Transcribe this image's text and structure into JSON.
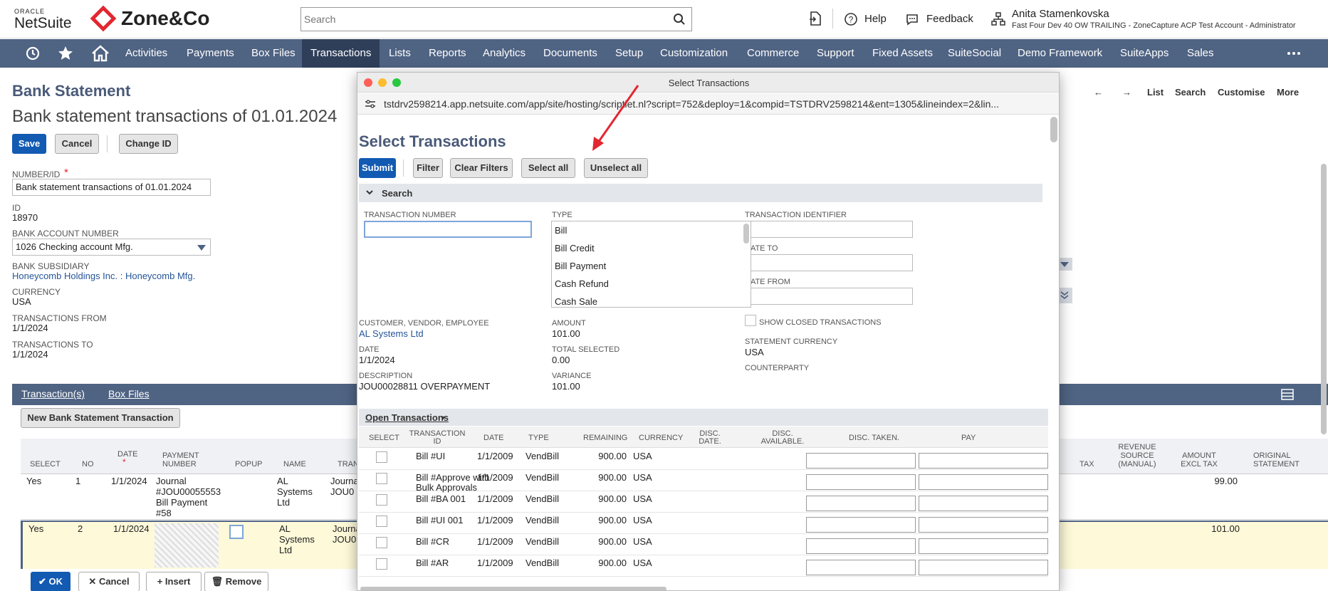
{
  "header": {
    "oracle_label": "ORACLE",
    "netsuite_label": "NetSuite",
    "zone_label": "Zone&Co",
    "search_placeholder": "Search",
    "help_label": "Help",
    "feedback_label": "Feedback",
    "user_name": "Anita Stamenkovska",
    "account": "Fast Four Dev 40 OW TRAILING - ZoneCapture ACP Test Account - Administrator",
    "brand_color": "#e3262f"
  },
  "nav": {
    "items": [
      "Activities",
      "Payments",
      "Box Files",
      "Transactions",
      "Lists",
      "Reports",
      "Analytics",
      "Documents",
      "Setup",
      "Customization",
      "Commerce",
      "Support",
      "Fixed Assets",
      "SuiteSocial",
      "Demo Framework",
      "SuiteApps",
      "Sales"
    ],
    "active": "Transactions",
    "color": "#4f6383"
  },
  "record": {
    "title": "Bank Statement",
    "subtitle": "Bank statement transactions of 01.01.2024",
    "save": "Save",
    "cancel": "Cancel",
    "change_id": "Change ID",
    "number_label": "NUMBER/ID",
    "number_value": "Bank statement transactions of 01.01.2024",
    "id_label": "ID",
    "id_value": "18970",
    "bank_account_label": "BANK ACCOUNT NUMBER",
    "bank_account_value": "1026 Checking account Mfg.",
    "subsidiary_label": "BANK SUBSIDIARY",
    "subsidiary_value": "Honeycomb Holdings Inc. : Honeycomb Mfg.",
    "currency_label": "CURRENCY",
    "currency_value": "USA",
    "from_label": "TRANSACTIONS FROM",
    "from_value": "1/1/2024",
    "to_label": "TRANSACTIONS TO",
    "to_value": "1/1/2024",
    "right_nav": [
      "List",
      "Search",
      "Customise",
      "More"
    ]
  },
  "subtabs": {
    "transactions": "Transaction(s)",
    "box_files": "Box Files",
    "new_button": "New Bank Statement Transaction"
  },
  "grid": {
    "headers": [
      "SELECT",
      "NO",
      "DATE",
      "PAYMENT NUMBER",
      "POPUP",
      "NAME",
      "TRAN"
    ],
    "right_headers": [
      "TAX",
      "REVENUE SOURCE (MANUAL)",
      "AMOUNT EXCL TAX",
      "ORIGINAL STATEMENT"
    ],
    "rows": [
      {
        "select": "Yes",
        "no": "1",
        "date": "1/1/2024",
        "payment": "Journal #JOU00055553 Bill Payment #58",
        "name": "AL Systems Ltd",
        "tran": "Journa JOU0",
        "amount": "99.00"
      },
      {
        "select": "Yes",
        "no": "2",
        "date": "1/1/2024",
        "payment": "",
        "name": "AL Systems Ltd",
        "tran": "Journa JOU0",
        "amount": "101.00"
      }
    ],
    "ok": "OK",
    "cancel": "Cancel",
    "insert": "Insert",
    "remove": "Remove"
  },
  "popup": {
    "window_title": "Select Transactions",
    "url": "tstdrv2598214.app.netsuite.com/app/site/hosting/scriptlet.nl?script=752&deploy=1&compid=TSTDRV2598214&ent=1305&lineindex=2&lin...",
    "title": "Select Transactions",
    "submit": "Submit",
    "filter": "Filter",
    "clear_filters": "Clear Filters",
    "select_all": "Select all",
    "unselect_all": "Unselect all",
    "search_label": "Search",
    "tran_number_label": "TRANSACTION NUMBER",
    "type_label": "TYPE",
    "types": [
      "Bill",
      "Bill Credit",
      "Bill Payment",
      "Cash Refund",
      "Cash Sale"
    ],
    "tran_identifier_label": "TRANSACTION IDENTIFIER",
    "date_to_label": "DATE TO",
    "date_from_label": "DATE FROM",
    "show_closed_label": "SHOW CLOSED TRANSACTIONS",
    "customer_label": "CUSTOMER, VENDOR, EMPLOYEE",
    "customer_value": "AL Systems Ltd",
    "date_label": "DATE",
    "date_value": "1/1/2024",
    "description_label": "DESCRIPTION",
    "description_value": "JOU00028811 OVERPAYMENT",
    "amount_label": "AMOUNT",
    "amount_value": "101.00",
    "total_selected_label": "TOTAL SELECTED",
    "total_selected_value": "0.00",
    "variance_label": "VARIANCE",
    "variance_value": "101.00",
    "statement_currency_label": "STATEMENT CURRENCY",
    "statement_currency_value": "USA",
    "counterparty_label": "COUNTERPARTY",
    "open_tab": "Open Transactions",
    "open_headers": [
      "SELECT",
      "TRANSACTION ID",
      "DATE",
      "TYPE",
      "REMAINING",
      "CURRENCY",
      "DISC. DATE.",
      "DISC. AVAILABLE.",
      "DISC. TAKEN.",
      "PAY"
    ],
    "open_rows": [
      {
        "id": "Bill #UI",
        "date": "1/1/2009",
        "type": "VendBill",
        "remaining": "900.00",
        "currency": "USA"
      },
      {
        "id": "Bill #Approve with Bulk Approvals",
        "date": "1/1/2009",
        "type": "VendBill",
        "remaining": "900.00",
        "currency": "USA"
      },
      {
        "id": "Bill #BA 001",
        "date": "1/1/2009",
        "type": "VendBill",
        "remaining": "900.00",
        "currency": "USA"
      },
      {
        "id": "Bill #UI 001",
        "date": "1/1/2009",
        "type": "VendBill",
        "remaining": "900.00",
        "currency": "USA"
      },
      {
        "id": "Bill #CR",
        "date": "1/1/2009",
        "type": "VendBill",
        "remaining": "900.00",
        "currency": "USA"
      },
      {
        "id": "Bill #AR",
        "date": "1/1/2009",
        "type": "VendBill",
        "remaining": "900.00",
        "currency": "USA"
      }
    ],
    "primary_color": "#125ab2"
  }
}
